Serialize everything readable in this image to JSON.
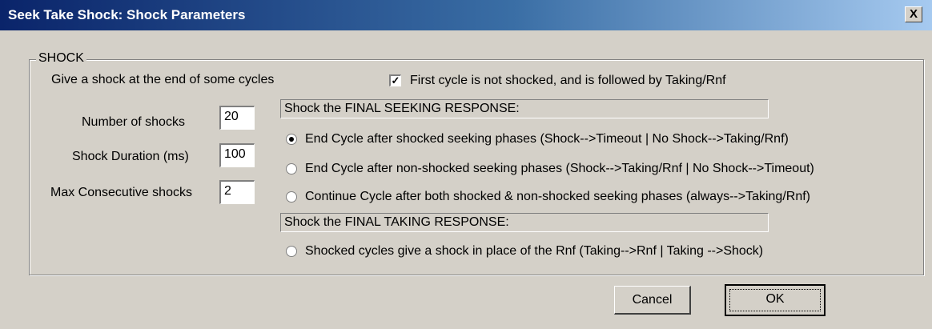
{
  "window": {
    "title": "Seek Take Shock: Shock Parameters",
    "close_label": "X"
  },
  "shock": {
    "group_label": "SHOCK",
    "description": "Give a shock at the end of some cycles",
    "first_cycle_checkbox": {
      "label": "First cycle is not shocked, and is followed by Taking/Rnf",
      "checked": true
    },
    "number_of_shocks": {
      "label": "Number of shocks",
      "value": "20"
    },
    "shock_duration": {
      "label": "Shock Duration (ms)",
      "value": "100"
    },
    "max_consecutive": {
      "label": "Max Consecutive shocks",
      "value": "2"
    },
    "seeking_header": "Shock the FINAL SEEKING RESPONSE:",
    "seeking_options": [
      {
        "label": "End Cycle after shocked seeking phases (Shock-->Timeout | No Shock-->Taking/Rnf)",
        "selected": true
      },
      {
        "label": "End Cycle after non-shocked seeking phases (Shock-->Taking/Rnf | No Shock-->Timeout)",
        "selected": false
      },
      {
        "label": "Continue Cycle after both shocked & non-shocked seeking phases (always-->Taking/Rnf)",
        "selected": false
      }
    ],
    "taking_header": "Shock the FINAL TAKING RESPONSE:",
    "taking_options": [
      {
        "label": "Shocked cycles give a shock in place of the Rnf (Taking-->Rnf | Taking -->Shock)",
        "selected": false
      }
    ]
  },
  "buttons": {
    "cancel": "Cancel",
    "ok": "OK"
  },
  "colors": {
    "dialog_bg": "#d4d0c8",
    "titlebar_start": "#0a246a",
    "titlebar_end": "#a6caf0"
  }
}
